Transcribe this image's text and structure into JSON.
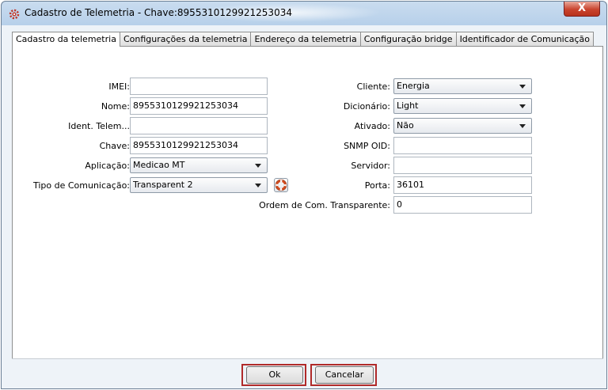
{
  "window": {
    "title": "Cadastro de Telemetria - Chave:8955310129921253034",
    "close_glyph": "X",
    "app_icon": "gear-icon"
  },
  "tabs": [
    {
      "label": "Cadastro da telemetria",
      "active": true
    },
    {
      "label": "Configurações da telemetria"
    },
    {
      "label": "Endereço da telemetria"
    },
    {
      "label": "Configuração bridge"
    },
    {
      "label": "Identificador de Comunicação"
    }
  ],
  "form_left": {
    "imei": {
      "label": "IMEI:",
      "value": ""
    },
    "nome": {
      "label": "Nome:",
      "value": "8955310129921253034"
    },
    "ident": {
      "label": "Ident. Telem...",
      "value": ""
    },
    "chave": {
      "label": "Chave:",
      "value": "8955310129921253034"
    },
    "aplicacao": {
      "label": "Aplicação:",
      "value": "Medicao MT"
    },
    "tipo_comunicacao": {
      "label": "Tipo de Comunicação:",
      "value": "Transparent 2"
    }
  },
  "form_right": {
    "cliente": {
      "label": "Cliente:",
      "value": "Energia"
    },
    "dicionario": {
      "label": "Dicionário:",
      "value": "Light"
    },
    "ativado": {
      "label": "Ativado:",
      "value": "Não"
    },
    "snmp_oid": {
      "label": "SNMP OID:",
      "value": ""
    },
    "servidor": {
      "label": "Servidor:",
      "value": ""
    },
    "porta": {
      "label": "Porta:",
      "value": "36101"
    },
    "ordem": {
      "label": "Ordem de Com. Transparente:",
      "value": "0"
    }
  },
  "buttons": {
    "ok": "Ok",
    "cancel": "Cancelar"
  },
  "colors": {
    "highlight": "#b02a2a"
  }
}
